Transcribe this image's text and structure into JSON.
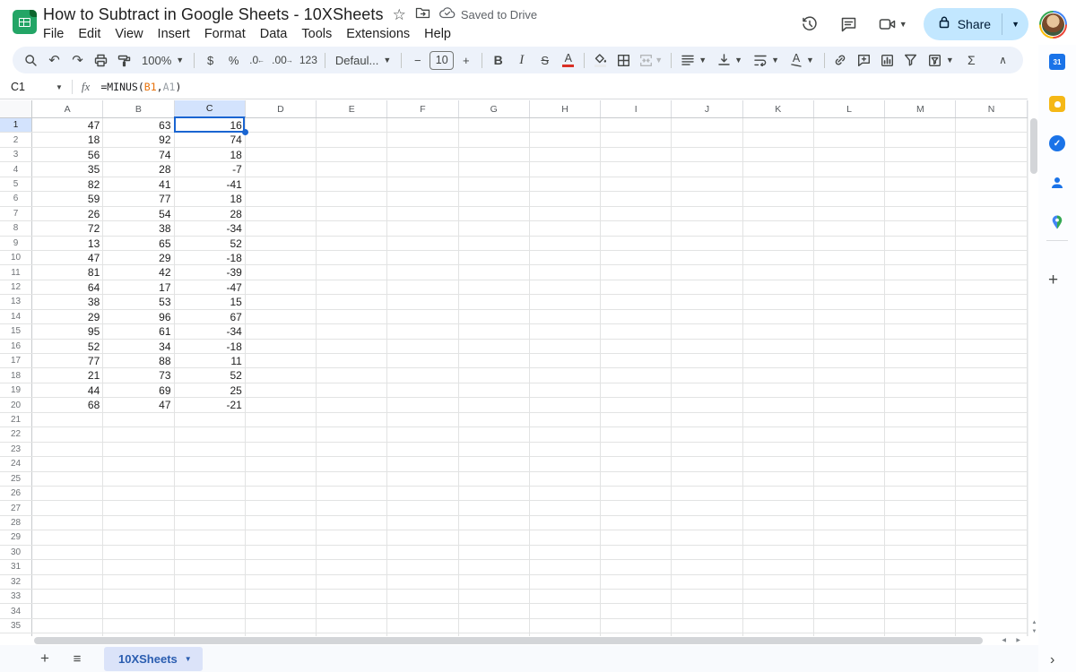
{
  "titlebar": {
    "title": "How to Subtract in Google Sheets - 10XSheets",
    "saved_status": "Saved to Drive",
    "menus": [
      "File",
      "Edit",
      "View",
      "Insert",
      "Format",
      "Data",
      "Tools",
      "Extensions",
      "Help"
    ],
    "share_label": "Share",
    "star_icon": "☆"
  },
  "toolbar": {
    "zoom": "100%",
    "currency": "$",
    "percent": "%",
    "decrease_decimal": ".0",
    "increase_decimal": ".00",
    "number_format": "123",
    "font_name": "Defaul...",
    "decrease_font": "−",
    "font_size": "10",
    "increase_font": "+",
    "bold": "B",
    "italic": "I",
    "strikethrough": "S",
    "text_color": "A",
    "text_rotation": "A",
    "functions": "Σ",
    "collapse": "∧",
    "undo": "↶",
    "redo": "↷"
  },
  "formula_bar": {
    "cell_reference": "C1",
    "fx_label": "fx",
    "formula": {
      "prefix": "=MINUS(",
      "ref1": "B1",
      "separator": ",",
      "ref2": "A1",
      "suffix": ")"
    }
  },
  "grid": {
    "columns": [
      "A",
      "B",
      "C",
      "D",
      "E",
      "F",
      "G",
      "H",
      "I",
      "J",
      "K",
      "L",
      "M",
      "N"
    ],
    "row_count": 36,
    "selected_cell": "C1",
    "selected_column": "C",
    "selected_row": 1,
    "data": [
      [
        47,
        63,
        16
      ],
      [
        18,
        92,
        74
      ],
      [
        56,
        74,
        18
      ],
      [
        35,
        28,
        -7
      ],
      [
        82,
        41,
        -41
      ],
      [
        59,
        77,
        18
      ],
      [
        26,
        54,
        28
      ],
      [
        72,
        38,
        -34
      ],
      [
        13,
        65,
        52
      ],
      [
        47,
        29,
        -18
      ],
      [
        81,
        42,
        -39
      ],
      [
        64,
        17,
        -47
      ],
      [
        38,
        53,
        15
      ],
      [
        29,
        96,
        67
      ],
      [
        95,
        61,
        -34
      ],
      [
        52,
        34,
        -18
      ],
      [
        77,
        88,
        11
      ],
      [
        21,
        73,
        52
      ],
      [
        44,
        69,
        25
      ],
      [
        68,
        47,
        -21
      ]
    ]
  },
  "sheet_bar": {
    "active_tab": "10XSheets"
  },
  "side_panel": {
    "icons": [
      {
        "name": "calendar",
        "label": "31"
      },
      {
        "name": "keep",
        "label": ""
      },
      {
        "name": "tasks",
        "label": "✓"
      },
      {
        "name": "contacts",
        "label": ""
      },
      {
        "name": "maps",
        "label": ""
      }
    ]
  },
  "colors": {
    "accent": "#1a65d1",
    "toolbar_bg": "#edf2fa",
    "share_bg": "#c2e7ff",
    "selection_highlight": "#d3e3fd",
    "tab_highlight": "#dbe3f9",
    "formula_ref1": "#e8710a",
    "formula_ref2": "#9aa0a6",
    "logo_green": "#23a566"
  }
}
